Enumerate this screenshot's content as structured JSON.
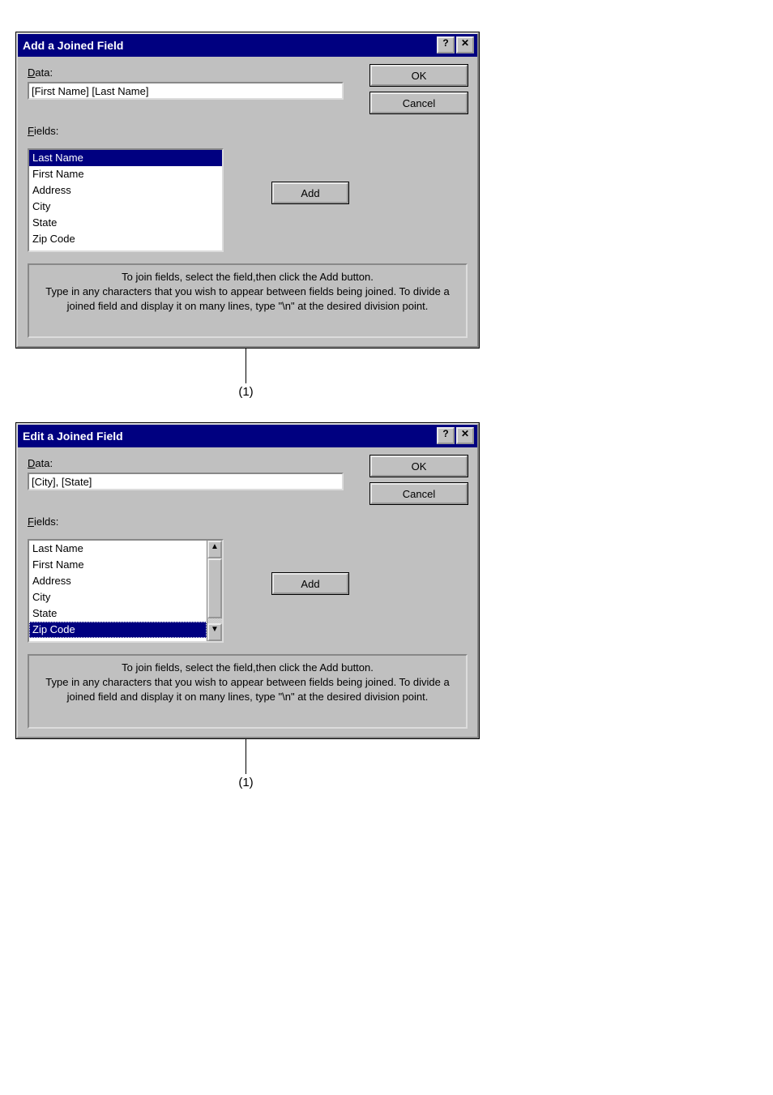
{
  "dialogs": [
    {
      "title": "Add a Joined Field",
      "data_label_prefix": "D",
      "data_label_rest": "ata:",
      "data_value": "[First Name] [Last Name]",
      "fields_label_prefix": "F",
      "fields_label_rest": "ields:",
      "fields": [
        "Last Name",
        "First Name",
        "Address",
        "City",
        "State",
        "Zip Code"
      ],
      "selected_index": 0,
      "has_scrollbar": false,
      "add_prefix": "A",
      "add_rest": "dd",
      "ok_label": "OK",
      "cancel_label": "Cancel",
      "help_glyph": "?",
      "close_glyph": "✕",
      "info_text": "To join fields, select the field,then click the Add button.\nType in any characters that you wish to appear between fields being joined.  To divide a joined field and display it on many lines, type \"\\n\" at the desired division point.",
      "callout": "(1)"
    },
    {
      "title": "Edit a Joined Field",
      "data_label_prefix": "D",
      "data_label_rest": "ata:",
      "data_value": "[City], [State]",
      "fields_label_prefix": "F",
      "fields_label_rest": "ields:",
      "fields": [
        "Last Name",
        "First Name",
        "Address",
        "City",
        "State",
        "Zip Code"
      ],
      "selected_index": 5,
      "has_scrollbar": true,
      "add_prefix": "A",
      "add_rest": "dd",
      "ok_label": "OK",
      "cancel_label": "Cancel",
      "help_glyph": "?",
      "close_glyph": "✕",
      "info_text": "To join fields, select the field,then click the Add button.\nType in any characters that you wish to appear between fields being joined.  To divide a joined field and display it on many lines, type \"\\n\" at the desired division point.",
      "callout": "(1)"
    }
  ]
}
